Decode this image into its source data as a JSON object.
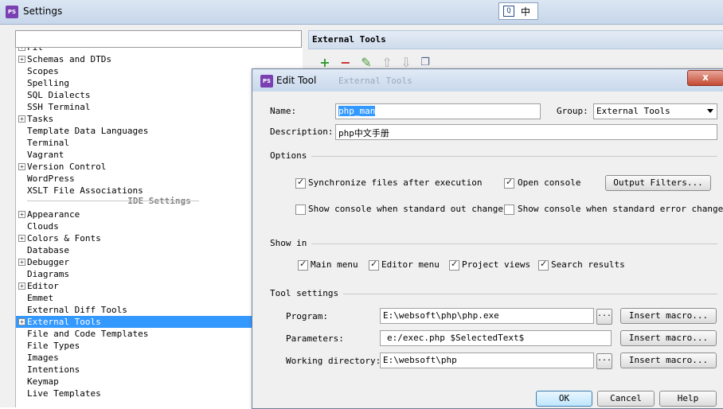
{
  "settings_window": {
    "title": "Settings"
  },
  "ime": {
    "icon": "ime-icon",
    "label": "中"
  },
  "tree": {
    "items_top": [
      {
        "label": "Schemas and DTDs",
        "expandable": true
      },
      {
        "label": "Scopes",
        "expandable": false
      },
      {
        "label": "Spelling",
        "expandable": false
      },
      {
        "label": "SQL Dialects",
        "expandable": false
      },
      {
        "label": "SSH Terminal",
        "expandable": false
      },
      {
        "label": "Tasks",
        "expandable": true
      },
      {
        "label": "Template Data Languages",
        "expandable": false
      },
      {
        "label": "Terminal",
        "expandable": false
      },
      {
        "label": "Vagrant",
        "expandable": false
      },
      {
        "label": "Version Control",
        "expandable": true
      },
      {
        "label": "WordPress",
        "expandable": false
      },
      {
        "label": "XSLT File Associations",
        "expandable": false
      }
    ],
    "section_label": "IDE Settings",
    "items_ide": [
      {
        "label": "Appearance",
        "expandable": true
      },
      {
        "label": "Clouds",
        "expandable": false
      },
      {
        "label": "Colors & Fonts",
        "expandable": true
      },
      {
        "label": "Database",
        "expandable": false
      },
      {
        "label": "Debugger",
        "expandable": true
      },
      {
        "label": "Diagrams",
        "expandable": false
      },
      {
        "label": "Editor",
        "expandable": true
      },
      {
        "label": "Emmet",
        "expandable": false
      },
      {
        "label": "External Diff Tools",
        "expandable": false
      },
      {
        "label": "External Tools",
        "expandable": true,
        "selected": true
      },
      {
        "label": "File and Code Templates",
        "expandable": false
      },
      {
        "label": "File Types",
        "expandable": false
      },
      {
        "label": "Images",
        "expandable": false
      },
      {
        "label": "Intentions",
        "expandable": false
      },
      {
        "label": "Keymap",
        "expandable": false
      },
      {
        "label": "Live Templates",
        "expandable": false
      }
    ]
  },
  "right_panel": {
    "title": "External Tools",
    "toolbar_icons": [
      "add-icon",
      "remove-icon",
      "edit-icon",
      "move-up-icon",
      "move-down-icon",
      "copy-icon"
    ]
  },
  "dialog": {
    "title": "Edit Tool",
    "ghost_title": "External Tools",
    "close_label": "x",
    "name_label": "Name:",
    "name_value": "php_man",
    "group_label": "Group:",
    "group_value": "External Tools",
    "description_label": "Description:",
    "description_value": "php中文手册",
    "options": {
      "title": "Options",
      "sync_files": {
        "label": "Synchronize files after execution",
        "checked": true
      },
      "open_console": {
        "label": "Open console",
        "checked": true
      },
      "output_filters_label": "Output Filters...",
      "show_console_out": {
        "label": "Show console when standard out changes",
        "checked": false
      },
      "show_console_err": {
        "label": "Show console when standard error changes",
        "checked": false
      }
    },
    "show_in": {
      "title": "Show in",
      "main_menu": {
        "label": "Main menu",
        "checked": true
      },
      "editor_menu": {
        "label": "Editor menu",
        "checked": true
      },
      "project_views": {
        "label": "Project views",
        "checked": true
      },
      "search_results": {
        "label": "Search results",
        "checked": true
      }
    },
    "tool_settings": {
      "title": "Tool settings",
      "program_label": "Program:",
      "program_value": "E:\\websoft\\php\\php.exe",
      "parameters_label": "Parameters:",
      "parameters_value": "e:/exec.php $SelectedText$",
      "workdir_label": "Working directory:",
      "workdir_value": "E:\\websoft\\php",
      "browse_label": "...",
      "insert_macro_label": "Insert macro..."
    },
    "ok_label": "OK",
    "cancel_label": "Cancel",
    "help_label": "Help"
  }
}
